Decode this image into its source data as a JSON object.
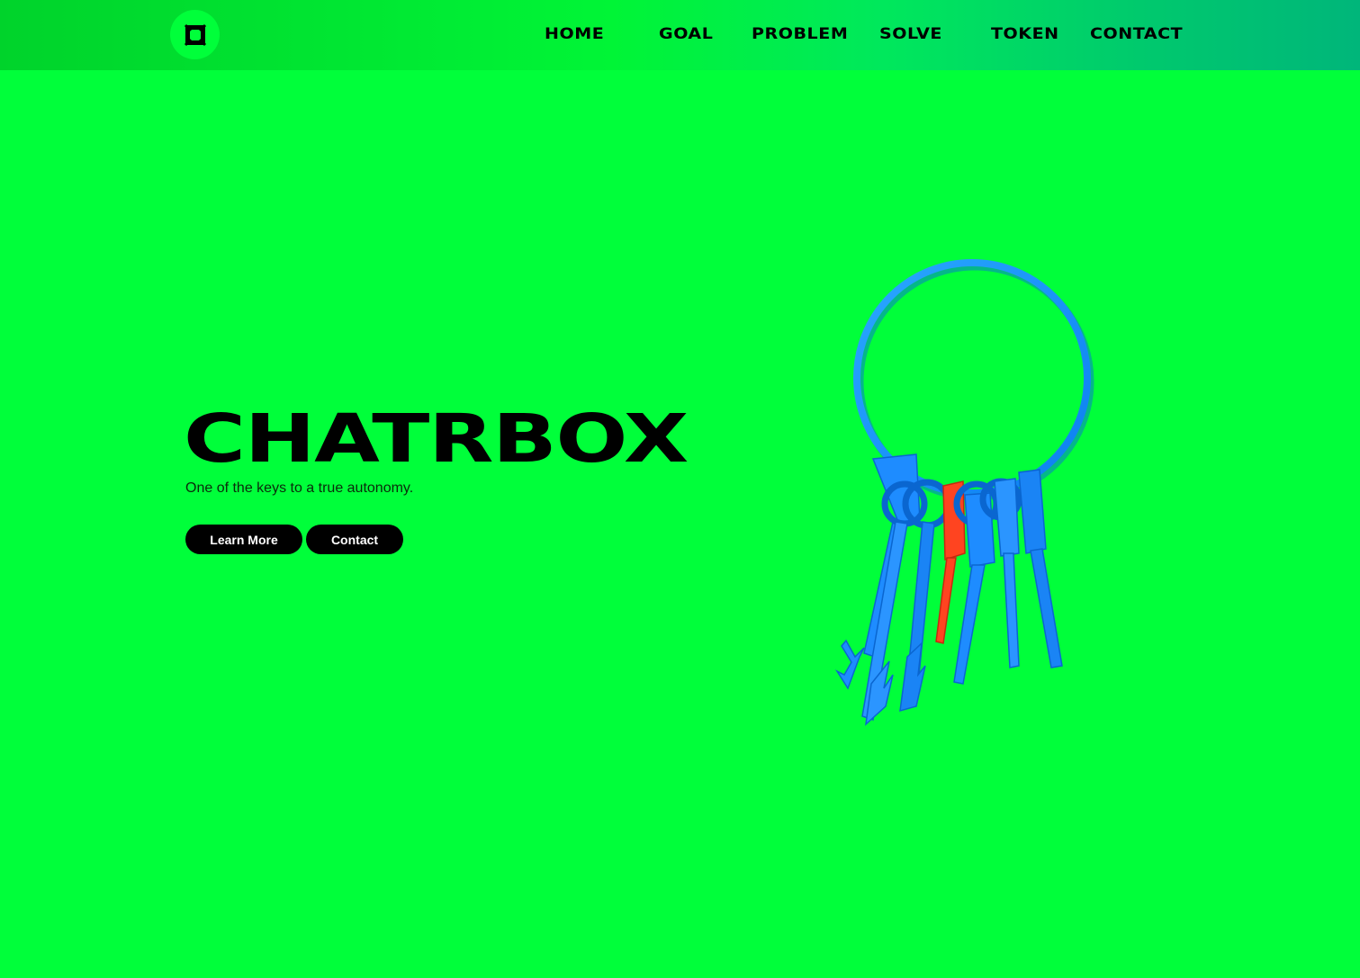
{
  "header": {
    "logo_icon": "square-logo-icon",
    "nav": {
      "home": "HOME",
      "goal": "GOAL",
      "problem": "PROBLEM",
      "solve": "SOLVE",
      "token": "TOKEN",
      "contact": "CONTACT"
    }
  },
  "hero": {
    "title": "CHATRBOX",
    "subtitle": "One of the keys to a true autonomy.",
    "learn_more_label": "Learn More",
    "contact_label": "Contact",
    "image_icon": "keyring-illustration"
  },
  "colors": {
    "background": "#00ff3a",
    "header_start": "#00d32b",
    "header_end": "#00b67a",
    "button": "#000000",
    "key_blue": "#1e90ff",
    "key_red": "#ff3b1f"
  }
}
